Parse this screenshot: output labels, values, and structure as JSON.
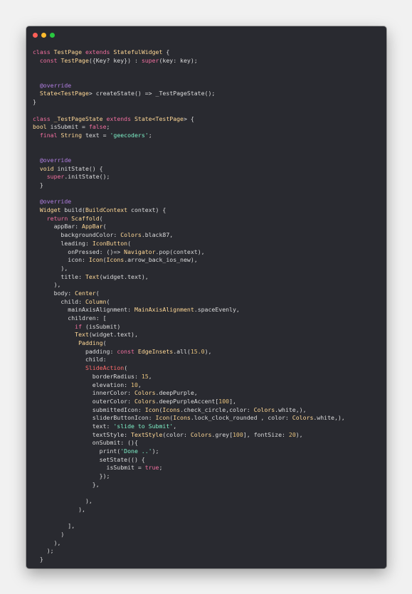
{
  "window": {
    "controls": [
      "close-icon",
      "minimize-icon",
      "zoom-icon"
    ],
    "colors": {
      "close": "#fe5f57",
      "minimize": "#febb2e",
      "zoom": "#29c840",
      "background": "#292a30"
    }
  },
  "code_lines": [
    [
      {
        "t": "class ",
        "c": "kw"
      },
      {
        "t": "TestPage ",
        "c": "ty"
      },
      {
        "t": "extends ",
        "c": "kw"
      },
      {
        "t": "StatefulWidget",
        "c": "ty"
      },
      {
        "t": " {",
        "c": "tx"
      }
    ],
    [
      {
        "t": "  ",
        "c": "tx"
      },
      {
        "t": "const ",
        "c": "kw"
      },
      {
        "t": "TestPage",
        "c": "ty"
      },
      {
        "t": "({Key? key}) : ",
        "c": "tx"
      },
      {
        "t": "super",
        "c": "kw"
      },
      {
        "t": "(key: key);",
        "c": "tx"
      }
    ],
    [],
    [],
    [
      {
        "t": "  ",
        "c": "tx"
      },
      {
        "t": "@override",
        "c": "at"
      }
    ],
    [
      {
        "t": "  ",
        "c": "tx"
      },
      {
        "t": "State<",
        "c": "ty"
      },
      {
        "t": "TestPage",
        "c": "ty"
      },
      {
        "t": "> createState() => _TestPageState();",
        "c": "tx"
      }
    ],
    [
      {
        "t": "}",
        "c": "tx"
      }
    ],
    [],
    [
      {
        "t": "class ",
        "c": "kw"
      },
      {
        "t": "_TestPageState ",
        "c": "ty"
      },
      {
        "t": "extends ",
        "c": "kw"
      },
      {
        "t": "State<",
        "c": "ty"
      },
      {
        "t": "TestPage",
        "c": "ty"
      },
      {
        "t": "> {",
        "c": "tx"
      }
    ],
    [
      {
        "t": "bool ",
        "c": "ty"
      },
      {
        "t": "isSubmit = ",
        "c": "tx"
      },
      {
        "t": "false",
        "c": "kw"
      },
      {
        "t": ";",
        "c": "tx"
      }
    ],
    [
      {
        "t": "  ",
        "c": "tx"
      },
      {
        "t": "final ",
        "c": "kw"
      },
      {
        "t": "String ",
        "c": "ty"
      },
      {
        "t": "text = ",
        "c": "tx"
      },
      {
        "t": "'geecoders'",
        "c": "st"
      },
      {
        "t": ";",
        "c": "tx"
      }
    ],
    [],
    [],
    [
      {
        "t": "  ",
        "c": "tx"
      },
      {
        "t": "@override",
        "c": "at"
      }
    ],
    [
      {
        "t": "  ",
        "c": "tx"
      },
      {
        "t": "void ",
        "c": "ty"
      },
      {
        "t": "initState() {",
        "c": "tx"
      }
    ],
    [
      {
        "t": "    ",
        "c": "tx"
      },
      {
        "t": "super",
        "c": "kw"
      },
      {
        "t": ".initState();",
        "c": "tx"
      }
    ],
    [
      {
        "t": "  }",
        "c": "tx"
      }
    ],
    [],
    [
      {
        "t": "  ",
        "c": "tx"
      },
      {
        "t": "@override",
        "c": "at"
      }
    ],
    [
      {
        "t": "  ",
        "c": "tx"
      },
      {
        "t": "Widget ",
        "c": "ty"
      },
      {
        "t": "build(",
        "c": "tx"
      },
      {
        "t": "BuildContext ",
        "c": "ty"
      },
      {
        "t": "context) {",
        "c": "tx"
      }
    ],
    [
      {
        "t": "    ",
        "c": "tx"
      },
      {
        "t": "return ",
        "c": "kw"
      },
      {
        "t": "Scaffold",
        "c": "ty"
      },
      {
        "t": "(",
        "c": "tx"
      }
    ],
    [
      {
        "t": "      appBar: ",
        "c": "tx"
      },
      {
        "t": "AppBar",
        "c": "ty"
      },
      {
        "t": "(",
        "c": "tx"
      }
    ],
    [
      {
        "t": "        backgroundColor: ",
        "c": "tx"
      },
      {
        "t": "Colors",
        "c": "ty"
      },
      {
        "t": ".black87,",
        "c": "tx"
      }
    ],
    [
      {
        "t": "        leading: ",
        "c": "tx"
      },
      {
        "t": "IconButton",
        "c": "ty"
      },
      {
        "t": "(",
        "c": "tx"
      }
    ],
    [
      {
        "t": "          onPressed: ()=> ",
        "c": "tx"
      },
      {
        "t": "Navigator",
        "c": "ty"
      },
      {
        "t": ".pop(context),",
        "c": "tx"
      }
    ],
    [
      {
        "t": "          icon: ",
        "c": "tx"
      },
      {
        "t": "Icon",
        "c": "ty"
      },
      {
        "t": "(",
        "c": "tx"
      },
      {
        "t": "Icons",
        "c": "ty"
      },
      {
        "t": ".arrow_back_ios_new),",
        "c": "tx"
      }
    ],
    [
      {
        "t": "        ),",
        "c": "tx"
      }
    ],
    [
      {
        "t": "        title: ",
        "c": "tx"
      },
      {
        "t": "Text",
        "c": "ty"
      },
      {
        "t": "(widget.text),",
        "c": "tx"
      }
    ],
    [
      {
        "t": "      ),",
        "c": "tx"
      }
    ],
    [
      {
        "t": "      body: ",
        "c": "tx"
      },
      {
        "t": "Center",
        "c": "ty"
      },
      {
        "t": "(",
        "c": "tx"
      }
    ],
    [
      {
        "t": "        child: ",
        "c": "tx"
      },
      {
        "t": "Column",
        "c": "ty"
      },
      {
        "t": "(",
        "c": "tx"
      }
    ],
    [
      {
        "t": "          mainAxisAlignment: ",
        "c": "tx"
      },
      {
        "t": "MainAxisAlignment",
        "c": "ty"
      },
      {
        "t": ".spaceEvenly,",
        "c": "tx"
      }
    ],
    [
      {
        "t": "          children: [",
        "c": "tx"
      }
    ],
    [
      {
        "t": "            ",
        "c": "tx"
      },
      {
        "t": "if ",
        "c": "kw"
      },
      {
        "t": "(isSubmit)",
        "c": "tx"
      }
    ],
    [
      {
        "t": "            ",
        "c": "tx"
      },
      {
        "t": "Text",
        "c": "ty"
      },
      {
        "t": "(widget.text),",
        "c": "tx"
      }
    ],
    [
      {
        "t": "             ",
        "c": "tx"
      },
      {
        "t": "Padding",
        "c": "ty"
      },
      {
        "t": "(",
        "c": "tx"
      }
    ],
    [
      {
        "t": "               padding: ",
        "c": "tx"
      },
      {
        "t": "const ",
        "c": "kw"
      },
      {
        "t": "EdgeInsets",
        "c": "ty"
      },
      {
        "t": ".all(",
        "c": "tx"
      },
      {
        "t": "15.0",
        "c": "nu"
      },
      {
        "t": "),",
        "c": "tx"
      }
    ],
    [
      {
        "t": "               child:",
        "c": "tx"
      }
    ],
    [
      {
        "t": "               ",
        "c": "tx"
      },
      {
        "t": "SlideAction",
        "c": "er"
      },
      {
        "t": "(",
        "c": "tx"
      }
    ],
    [
      {
        "t": "                 borderRadius: ",
        "c": "tx"
      },
      {
        "t": "15",
        "c": "nu"
      },
      {
        "t": ",",
        "c": "tx"
      }
    ],
    [
      {
        "t": "                 elevation: ",
        "c": "tx"
      },
      {
        "t": "10",
        "c": "nu"
      },
      {
        "t": ",",
        "c": "tx"
      }
    ],
    [
      {
        "t": "                 innerColor: ",
        "c": "tx"
      },
      {
        "t": "Colors",
        "c": "ty"
      },
      {
        "t": ".deepPurple,",
        "c": "tx"
      }
    ],
    [
      {
        "t": "                 outerColor: ",
        "c": "tx"
      },
      {
        "t": "Colors",
        "c": "ty"
      },
      {
        "t": ".deepPurpleAccent[",
        "c": "tx"
      },
      {
        "t": "100",
        "c": "nu"
      },
      {
        "t": "],",
        "c": "tx"
      }
    ],
    [
      {
        "t": "                 submittedIcon: ",
        "c": "tx"
      },
      {
        "t": "Icon",
        "c": "ty"
      },
      {
        "t": "(",
        "c": "tx"
      },
      {
        "t": "Icons",
        "c": "ty"
      },
      {
        "t": ".check_circle,color: ",
        "c": "tx"
      },
      {
        "t": "Colors",
        "c": "ty"
      },
      {
        "t": ".white,),",
        "c": "tx"
      }
    ],
    [
      {
        "t": "                 sliderButtonIcon: ",
        "c": "tx"
      },
      {
        "t": "Icon",
        "c": "ty"
      },
      {
        "t": "(",
        "c": "tx"
      },
      {
        "t": "Icons",
        "c": "ty"
      },
      {
        "t": ".lock_clock_rounded , color: ",
        "c": "tx"
      },
      {
        "t": "Colors",
        "c": "ty"
      },
      {
        "t": ".white,),",
        "c": "tx"
      }
    ],
    [
      {
        "t": "                 text: ",
        "c": "tx"
      },
      {
        "t": "'slide to Submit'",
        "c": "st"
      },
      {
        "t": ",",
        "c": "tx"
      }
    ],
    [
      {
        "t": "                 textStyle: ",
        "c": "tx"
      },
      {
        "t": "TextStyle",
        "c": "ty"
      },
      {
        "t": "(color: ",
        "c": "tx"
      },
      {
        "t": "Colors",
        "c": "ty"
      },
      {
        "t": ".grey[",
        "c": "tx"
      },
      {
        "t": "100",
        "c": "nu"
      },
      {
        "t": "], fontSize: ",
        "c": "tx"
      },
      {
        "t": "20",
        "c": "nu"
      },
      {
        "t": "),",
        "c": "tx"
      }
    ],
    [
      {
        "t": "                 onSubmit: (){",
        "c": "tx"
      }
    ],
    [
      {
        "t": "                   print(",
        "c": "tx"
      },
      {
        "t": "'Done ..'",
        "c": "st"
      },
      {
        "t": ");",
        "c": "tx"
      }
    ],
    [
      {
        "t": "                   setState(() {",
        "c": "tx"
      }
    ],
    [
      {
        "t": "                     isSubmit = ",
        "c": "tx"
      },
      {
        "t": "true",
        "c": "kw"
      },
      {
        "t": ";",
        "c": "tx"
      }
    ],
    [
      {
        "t": "                   });",
        "c": "tx"
      }
    ],
    [
      {
        "t": "                 },",
        "c": "tx"
      }
    ],
    [],
    [
      {
        "t": "               ),",
        "c": "tx"
      }
    ],
    [
      {
        "t": "             ),",
        "c": "tx"
      }
    ],
    [],
    [
      {
        "t": "          ],",
        "c": "tx"
      }
    ],
    [
      {
        "t": "        )",
        "c": "tx"
      }
    ],
    [
      {
        "t": "      ),",
        "c": "tx"
      }
    ],
    [
      {
        "t": "    );",
        "c": "tx"
      }
    ],
    [
      {
        "t": "  }",
        "c": "tx"
      }
    ]
  ]
}
